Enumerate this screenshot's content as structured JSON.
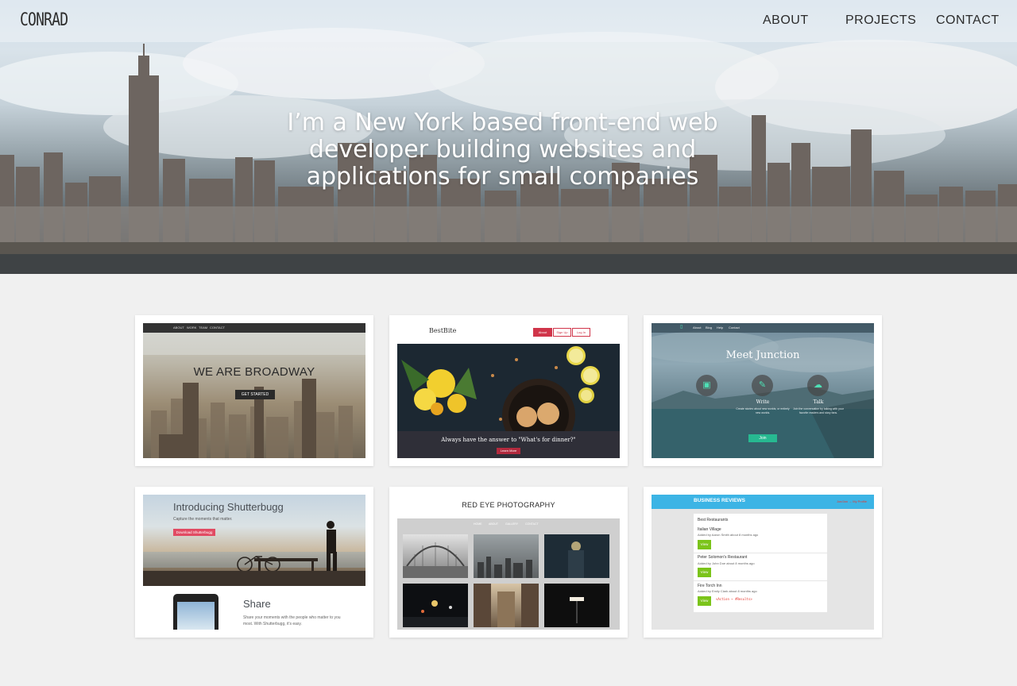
{
  "site": {
    "logo": "CONRAD",
    "nav": [
      {
        "label": "ABOUT"
      },
      {
        "label": "PROJECTS"
      },
      {
        "label": "CONTACT"
      }
    ]
  },
  "hero": {
    "headline": "I’m a New York based front-end web developer building websites and applications for small companies"
  },
  "projects": {
    "broadway": {
      "nav": [
        "ABOUT",
        "WORK",
        "TEAM",
        "CONTACT"
      ],
      "title": "WE ARE BROADWAY",
      "button": "GET STARTED"
    },
    "bestbite": {
      "brand": "BestBite",
      "buttons": [
        "About",
        "Sign Up",
        "Log In"
      ],
      "tagline": "Always have the answer to \"What's for dinner?\"",
      "cta": "Learn More"
    },
    "junction": {
      "nav": [
        "About",
        "Blog",
        "Help",
        "Contact"
      ],
      "title": "Meet Junction",
      "features": [
        {
          "name": "Write",
          "desc": "Create stories about new worlds, or entirely new worlds."
        },
        {
          "name": "Talk",
          "desc": "Join the conversation by talking with your favorite readers and story fans."
        }
      ],
      "cta": "Join"
    },
    "shutterbugg": {
      "title": "Introducing Shutterbugg",
      "subtitle": "Capture the moments that matter.",
      "button": "Download Shutterbugg",
      "share_title": "Share",
      "share_desc": "Share your moments with the people who matter to you most. With Shutterbugg, it's easy."
    },
    "redeye": {
      "title": "RED EYE PHOTOGRAPHY",
      "nav": [
        "HOME",
        "ABOUT",
        "GALLERY",
        "CONTACT"
      ]
    },
    "reviews": {
      "title": "BUSINESS REVIEWS",
      "header_link": "Joe/Jan → My Profile",
      "panel_title": "Best Restaurants",
      "items": [
        {
          "name": "Italian Village",
          "meta": "Added by Aaron Smith about 8 months ago",
          "button": "View"
        },
        {
          "name": "Peter Solomon's Restaurant",
          "meta": "Added by John Doe about 8 months ago",
          "button": "View"
        },
        {
          "name": "Fire Torch Inn",
          "meta": "Added by Emily Clark about 8 months ago",
          "button": "View"
        }
      ],
      "code": "<Action → #Results>"
    }
  }
}
